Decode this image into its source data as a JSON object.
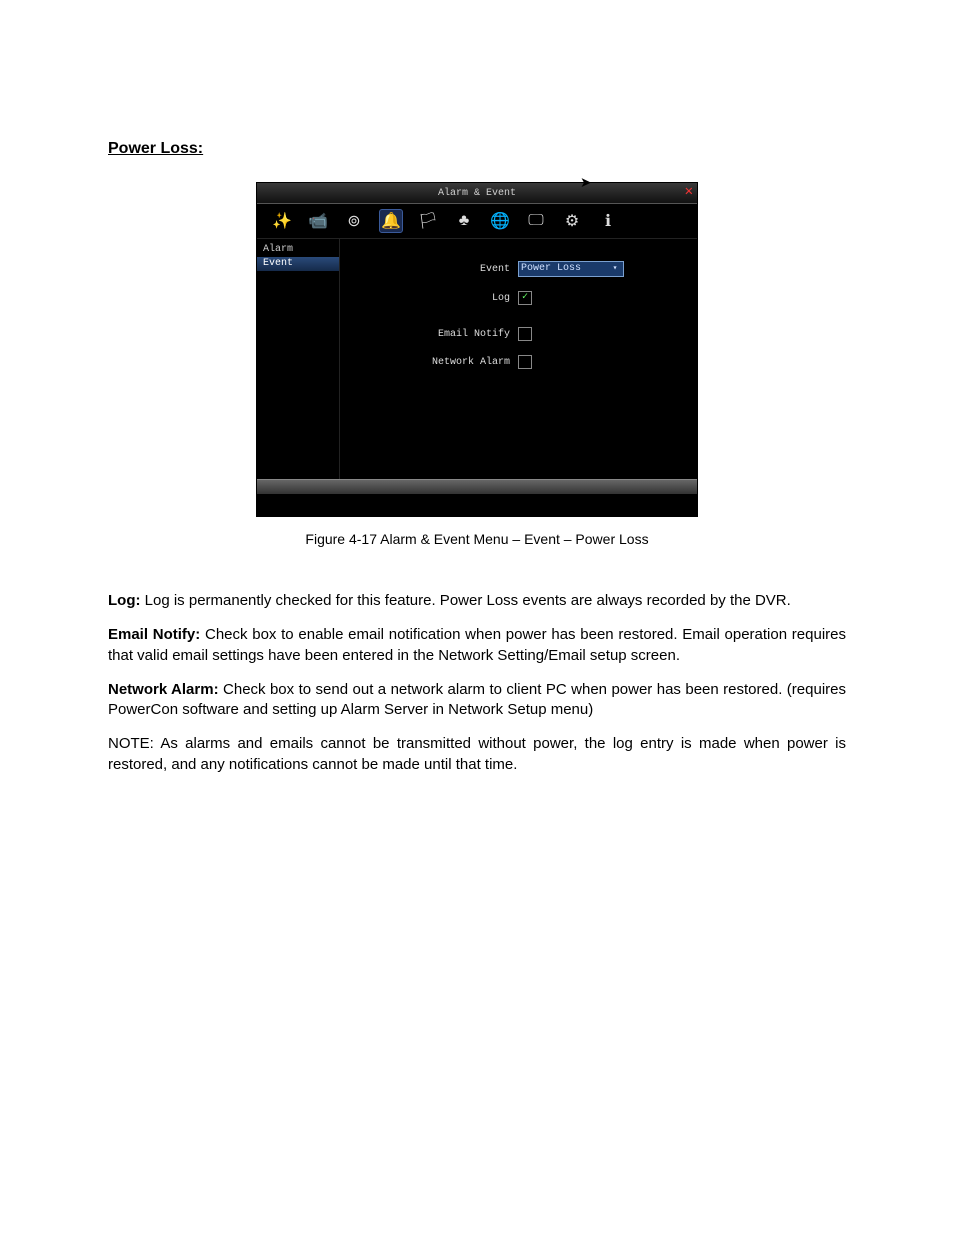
{
  "doc": {
    "heading": "Power Loss:",
    "caption": "Figure 4-17 Alarm & Event Menu – Event – Power Loss",
    "p_log_b": "Log:",
    "p_log": " Log is permanently checked for this feature. Power Loss events are always recorded by the DVR.",
    "p_email_b": "Email Notify:",
    "p_email": " Check box to enable email notification when power has been restored.  Email operation requires that valid email settings have been entered in the Network Setting/Email setup screen.",
    "p_net_b": "Network Alarm:",
    "p_net": " Check box to send out a network alarm to client PC when power has been restored. (requires PowerCon software and setting up Alarm Server in Network Setup menu)",
    "p_note": "NOTE: As alarms and emails cannot be transmitted without power, the log entry is made when power is restored, and any notifications cannot be made until that time."
  },
  "app": {
    "title": "Alarm & Event",
    "toolbar_icons": {
      "i1": "✨",
      "i2": "📹",
      "i3": "⊚",
      "i4": "🔔",
      "i5": "🏳",
      "i6": "♣",
      "i7": "🌐",
      "i8": "🖵",
      "i9": "⚙",
      "i10": "ℹ"
    },
    "sidebar": {
      "item1": "Alarm",
      "item2": "Event"
    },
    "panel": {
      "event_label": "Event",
      "event_value": "Power Loss",
      "log_label": "Log",
      "log_checked": "✓",
      "email_label": "Email Notify",
      "net_label": "Network Alarm"
    }
  }
}
